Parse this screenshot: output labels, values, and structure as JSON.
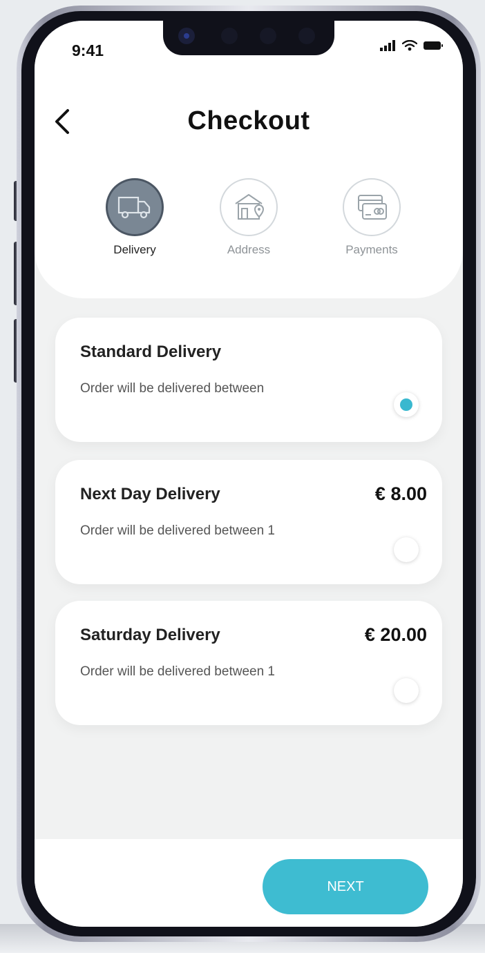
{
  "status_bar": {
    "time": "9:41"
  },
  "header": {
    "title": "Checkout"
  },
  "steps": [
    {
      "label": "Delivery",
      "icon": "truck-icon",
      "active": true
    },
    {
      "label": "Address",
      "icon": "house-location-icon",
      "active": false
    },
    {
      "label": "Payments",
      "icon": "credit-card-icon",
      "active": false
    }
  ],
  "delivery_options": [
    {
      "title": "Standard Delivery",
      "price": "",
      "description": "Order will be delivered between",
      "selected": true
    },
    {
      "title": "Next Day Delivery",
      "price": "€ 8.00",
      "description": "Order will be delivered between 1",
      "selected": false
    },
    {
      "title": "Saturday Delivery",
      "price": "€ 20.00",
      "description": "Order will be delivered between 1",
      "selected": false
    }
  ],
  "footer": {
    "next_label": "NEXT"
  },
  "colors": {
    "accent": "#3ebcd1",
    "background": "#f1f2f2",
    "card": "#ffffff",
    "active_step": "#7a8794"
  }
}
